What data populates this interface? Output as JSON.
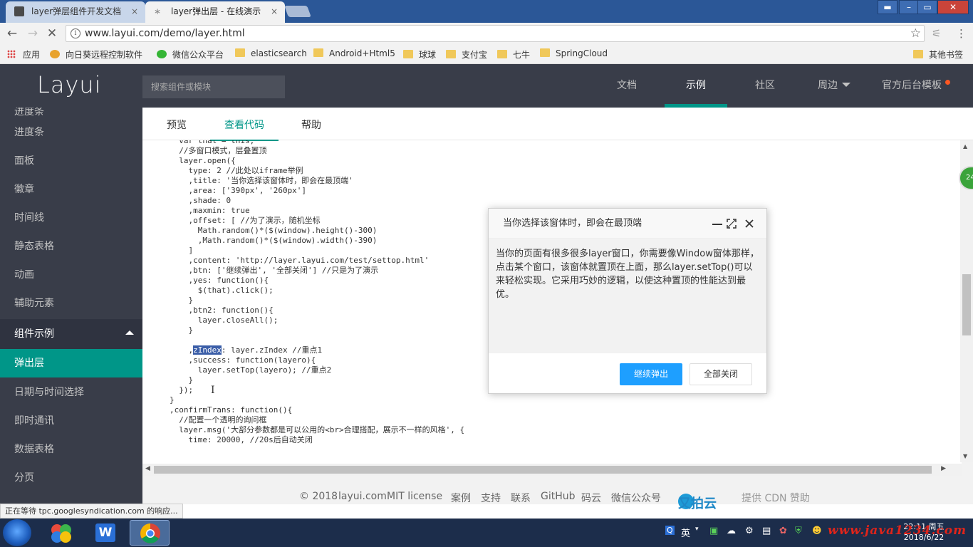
{
  "browser": {
    "tabs": [
      {
        "label": "layer弹层组件开发文档",
        "active": false
      },
      {
        "label": "layer弹出层 - 在线演示",
        "active": true
      }
    ],
    "url": "www.layui.com/demo/layer.html",
    "bookmarks": [
      "应用",
      "向日葵远程控制软件",
      "微信公众平台",
      "elasticsearch",
      "Android+Html5",
      "球球",
      "支付宝",
      "七牛",
      "SpringCloud"
    ],
    "other_bookmarks": "其他书签",
    "status_text": "正在等待 tpc.googlesyndication.com 的响应..."
  },
  "site": {
    "logo": "Layui",
    "search_placeholder": "搜索组件或模块",
    "nav": [
      {
        "label": "文档",
        "active": false
      },
      {
        "label": "示例",
        "active": true
      },
      {
        "label": "社区",
        "active": false
      },
      {
        "label": "周边",
        "active": false
      },
      {
        "label": "官方后台模板",
        "active": false
      }
    ]
  },
  "sidebar": {
    "items": [
      {
        "label": "进度条"
      },
      {
        "label": "面板"
      },
      {
        "label": "徽章"
      },
      {
        "label": "时间线"
      },
      {
        "label": "静态表格"
      },
      {
        "label": "动画"
      },
      {
        "label": "辅助元素"
      },
      {
        "label": "组件示例",
        "type": "group"
      },
      {
        "label": "弹出层",
        "type": "selected"
      },
      {
        "label": "日期与时间选择"
      },
      {
        "label": "即时通讯"
      },
      {
        "label": "数据表格"
      },
      {
        "label": "分页"
      }
    ]
  },
  "subtabs": [
    "预览",
    "查看代码",
    "帮助"
  ],
  "code_lines": [
    "  var that = this;",
    "  //多窗口模式，层叠置顶",
    "  layer.open({",
    "    type: 2 //此处以iframe举例",
    "    ,title: '当你选择该窗体时，即会在最顶端'",
    "    ,area: ['390px', '260px']",
    "    ,shade: 0",
    "    ,maxmin: true",
    "    ,offset: [ //为了演示，随机坐标",
    "      Math.random()*($(window).height()-300)",
    "      ,Math.random()*($(window).width()-390)",
    "    ]",
    "    ,content: 'http://layer.layui.com/test/settop.html'",
    "    ,btn: ['继续弹出', '全部关闭'] //只是为了演示",
    "    ,yes: function(){",
    "      $(that).click();",
    "    }",
    "    ,btn2: function(){",
    "      layer.closeAll();",
    "    }",
    "",
    "    ,zIndex: layer.zIndex //重点1",
    "    ,success: function(layero){",
    "      layer.setTop(layero); //重点2",
    "    }",
    "  });",
    "}",
    ",confirmTrans: function(){",
    "  //配置一个透明的询问框",
    "  layer.msg('大部分参数都是可以公用的<br>合理搭配，展示不一样的风格', {",
    "    time: 20000, //20s后自动关闭"
  ],
  "highlight": {
    "line": 21,
    "prefix": "    ,",
    "word": "zIndex",
    "suffix": ": layer.zIndex //重点1"
  },
  "dialog": {
    "title": "当你选择该窗体时，即会在最顶端",
    "body": "当你的页面有很多很多layer窗口，你需要像Window窗体那样，点击某个窗口，该窗体就置顶在上面，那么layer.setTop()可以来轻松实现。它采用巧妙的逻辑，以使这种置顶的性能达到最优。",
    "btn_primary": "继续弹出",
    "btn_secondary": "全部关闭"
  },
  "footer": {
    "copyright": "© 2018",
    "site": "layui.com",
    "license": "MIT license",
    "links": [
      "案例",
      "支持",
      "联系",
      "GitHub",
      "码云",
      "微信公众号"
    ],
    "cdn_brand": "又拍云",
    "cdn_text": "提供 CDN 赞助"
  },
  "badge": "24",
  "taskbar": {
    "ime": "英",
    "time": "22:11 周五",
    "date": "2018/6/22",
    "watermark": "www.java1234.com"
  }
}
